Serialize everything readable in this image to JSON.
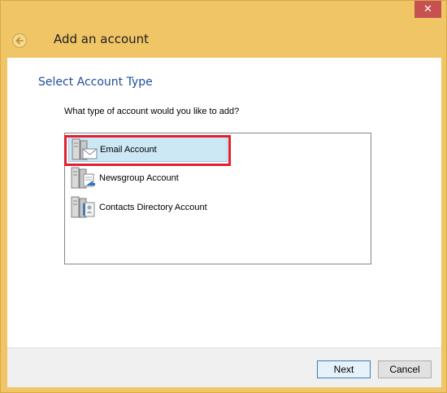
{
  "window": {
    "close_symbol": "✕"
  },
  "header": {
    "title": "Add an account"
  },
  "main": {
    "section_title": "Select Account Type",
    "prompt": "What type of account would you like to add?",
    "account_types": [
      {
        "label": "Email Account",
        "icon": "email-account-icon",
        "selected": true
      },
      {
        "label": "Newsgroup Account",
        "icon": "newsgroup-account-icon",
        "selected": false
      },
      {
        "label": "Contacts Directory Account",
        "icon": "contacts-directory-icon",
        "selected": false
      }
    ]
  },
  "footer": {
    "next_label": "Next",
    "cancel_label": "Cancel"
  },
  "colors": {
    "title_bar": "#F0C566",
    "section_title": "#1F4E9A",
    "selection": "#CCE8F4",
    "annotation_highlight": "#E0202E"
  }
}
